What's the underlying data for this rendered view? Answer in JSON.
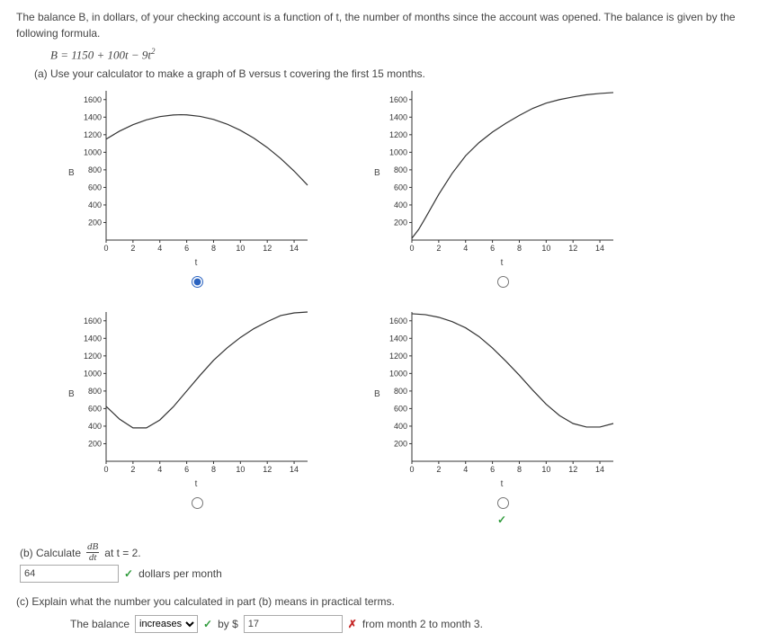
{
  "problem": {
    "intro": "The balance B, in dollars, of your checking account is a function of t, the number of months since the account was opened. The balance is given by the following formula.",
    "formula_lead": "B = 1150 + 100t − 9t",
    "formula_exp": "2"
  },
  "part_a": {
    "label": "(a) Use your calculator to make a graph of B versus t covering the first 15 months.",
    "y_axis": "B",
    "x_axis": "t",
    "y_ticks": [
      "200",
      "400",
      "600",
      "800",
      "1000",
      "1200",
      "1400",
      "1600"
    ],
    "x_ticks": [
      "0",
      "2",
      "4",
      "6",
      "8",
      "10",
      "12",
      "14"
    ],
    "selected_index": 0,
    "correct_index": 3
  },
  "part_b": {
    "label_prefix": "(b) Calculate",
    "frac_num": "dB",
    "frac_den": "dt",
    "label_suffix": "at t = 2.",
    "answer_value": "64",
    "after_answer": "dollars per month"
  },
  "part_c": {
    "label": "(c) Explain what the number you calculated in part (b) means in practical terms.",
    "sentence_start": "The balance",
    "select_value": "increases",
    "after_select": "by $",
    "answer_value": "17",
    "sentence_end": "from month 2 to month 3."
  },
  "chart_data": [
    {
      "type": "line",
      "points": [
        [
          0,
          1150
        ],
        [
          1,
          1241
        ],
        [
          2,
          1314
        ],
        [
          3,
          1369
        ],
        [
          4,
          1406
        ],
        [
          5,
          1425
        ],
        [
          5.56,
          1428
        ],
        [
          6,
          1426
        ],
        [
          7,
          1409
        ],
        [
          8,
          1374
        ],
        [
          9,
          1321
        ],
        [
          10,
          1250
        ],
        [
          11,
          1161
        ],
        [
          12,
          1054
        ],
        [
          13,
          929
        ],
        [
          14,
          786
        ],
        [
          15,
          625
        ]
      ],
      "xlim": [
        0,
        15
      ],
      "ylim": [
        0,
        1700
      ]
    },
    {
      "type": "line",
      "points": [
        [
          0,
          20
        ],
        [
          0.5,
          120
        ],
        [
          1,
          250
        ],
        [
          2,
          520
        ],
        [
          3,
          760
        ],
        [
          4,
          960
        ],
        [
          5,
          1110
        ],
        [
          6,
          1230
        ],
        [
          7,
          1330
        ],
        [
          8,
          1420
        ],
        [
          9,
          1500
        ],
        [
          10,
          1560
        ],
        [
          11,
          1600
        ],
        [
          12,
          1630
        ],
        [
          13,
          1655
        ],
        [
          14,
          1670
        ],
        [
          15,
          1680
        ]
      ],
      "xlim": [
        0,
        15
      ],
      "ylim": [
        0,
        1700
      ]
    },
    {
      "type": "line",
      "points": [
        [
          0,
          625
        ],
        [
          1,
          480
        ],
        [
          2,
          380
        ],
        [
          3,
          380
        ],
        [
          4,
          470
        ],
        [
          5,
          620
        ],
        [
          6,
          800
        ],
        [
          7,
          980
        ],
        [
          8,
          1150
        ],
        [
          9,
          1290
        ],
        [
          10,
          1410
        ],
        [
          11,
          1510
        ],
        [
          12,
          1590
        ],
        [
          13,
          1660
        ],
        [
          14,
          1690
        ],
        [
          15,
          1700
        ]
      ],
      "xlim": [
        0,
        15
      ],
      "ylim": [
        0,
        1700
      ]
    },
    {
      "type": "line",
      "points": [
        [
          0,
          1680
        ],
        [
          1,
          1670
        ],
        [
          2,
          1640
        ],
        [
          3,
          1590
        ],
        [
          4,
          1520
        ],
        [
          5,
          1420
        ],
        [
          6,
          1290
        ],
        [
          7,
          1140
        ],
        [
          8,
          980
        ],
        [
          9,
          810
        ],
        [
          10,
          650
        ],
        [
          11,
          520
        ],
        [
          12,
          430
        ],
        [
          13,
          390
        ],
        [
          14,
          390
        ],
        [
          15,
          430
        ]
      ],
      "xlim": [
        0,
        15
      ],
      "ylim": [
        0,
        1700
      ]
    }
  ]
}
